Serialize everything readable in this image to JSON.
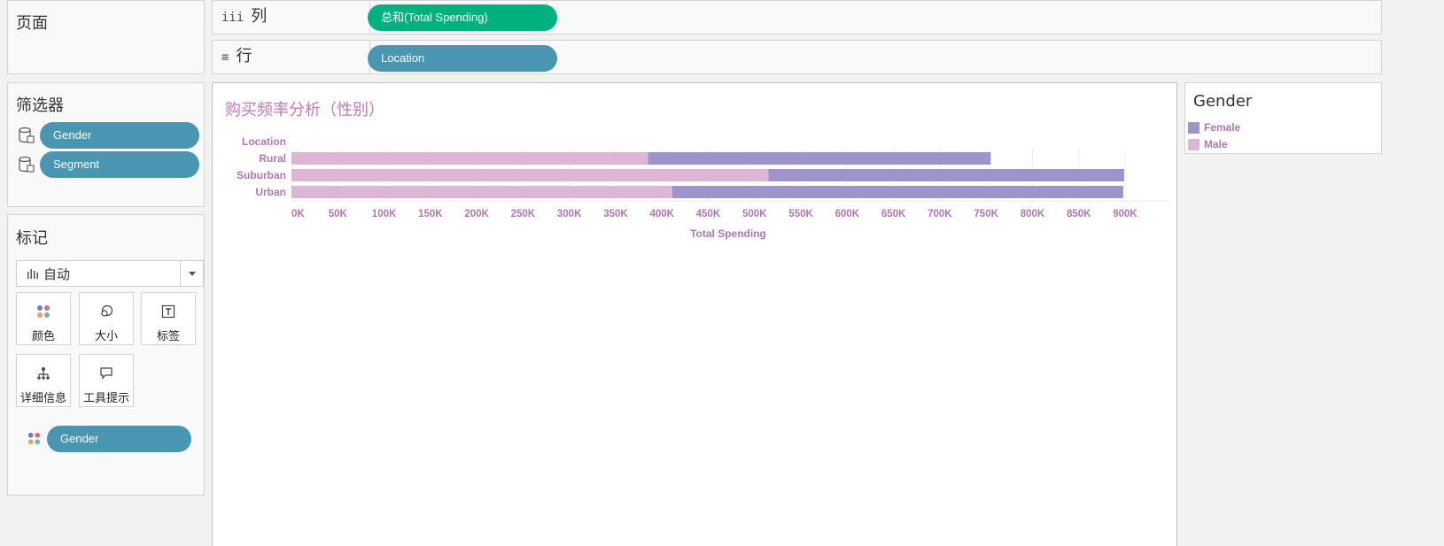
{
  "pages_panel": {
    "title": "页面"
  },
  "columns_shelf": {
    "icon": "iii",
    "label": "列",
    "pill": "总和(Total Spending)"
  },
  "rows_shelf": {
    "icon": "≡",
    "label": "行",
    "pill": "Location"
  },
  "filters_panel": {
    "title": "筛选器",
    "items": [
      "Gender",
      "Segment"
    ]
  },
  "marks_panel": {
    "title": "标记",
    "mark_type": "自动",
    "buttons": {
      "color": "颜色",
      "size": "大小",
      "label": "标签",
      "detail": "详细信息",
      "tooltip": "工具提示"
    },
    "field": "Gender"
  },
  "legend": {
    "title": "Gender",
    "items": [
      {
        "label": "Female",
        "color": "#9e94cb"
      },
      {
        "label": "Male",
        "color": "#ddb6d6"
      }
    ]
  },
  "chart_data": {
    "type": "bar",
    "orientation": "horizontal",
    "stacked": true,
    "title": "购买频率分析（性别）",
    "row_header": "Location",
    "categories": [
      "Rural",
      "Suburban",
      "Urban"
    ],
    "series": [
      {
        "name": "Male",
        "color": "#ddb6d6",
        "values": [
          385000,
          515000,
          411000
        ]
      },
      {
        "name": "Female",
        "color": "#9e94cb",
        "values": [
          370000,
          384000,
          487000
        ]
      }
    ],
    "xlabel": "Total Spending",
    "xlim": [
      0,
      900000
    ],
    "xticks": [
      "0K",
      "50K",
      "100K",
      "150K",
      "200K",
      "250K",
      "300K",
      "350K",
      "400K",
      "450K",
      "500K",
      "550K",
      "600K",
      "650K",
      "700K",
      "750K",
      "800K",
      "850K",
      "900K"
    ],
    "grid": true,
    "text_color": "#b077b0"
  }
}
